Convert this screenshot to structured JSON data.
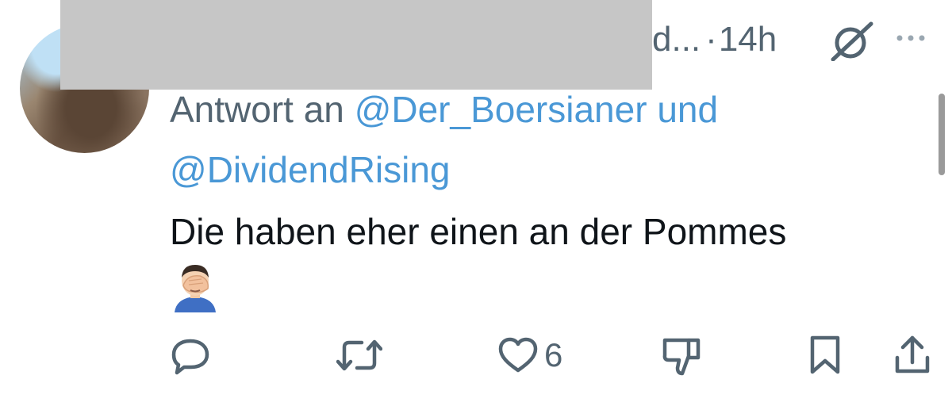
{
  "tweet": {
    "meta_name_tail": "d...",
    "separator": "·",
    "timestamp": "14h",
    "reply_prefix": "Antwort an",
    "mention_1": "@Der_Boersianer",
    "reply_conjunction": "und",
    "mention_2": "@DividendRising",
    "text": "Die haben eher einen an der Pommes",
    "emoji_name": "man-facepalming-emoji"
  },
  "actions": {
    "reply_icon": "reply-icon",
    "retweet_icon": "retweet-icon",
    "like_icon": "heart-icon",
    "like_count": "6",
    "dislike_icon": "thumbs-down-icon",
    "bookmark_icon": "bookmark-icon",
    "share_icon": "share-icon"
  },
  "colors": {
    "link": "#4a98d6",
    "secondary_text": "#536471",
    "primary_text": "#0f1419",
    "redaction": "#c6c6c6"
  }
}
